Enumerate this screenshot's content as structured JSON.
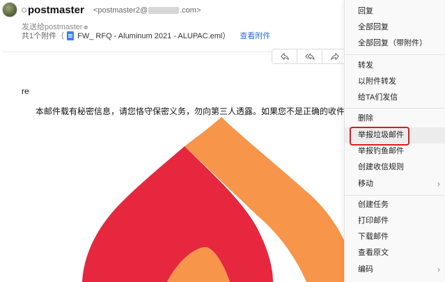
{
  "header": {
    "sender_name": "postmaster",
    "sender_email_prefix": "<postmaster2@",
    "sender_email_suffix": ".com>",
    "to_label": "发送给postmaster",
    "to_caret": "≑",
    "attachment_count_label": "共1个附件（",
    "attachment_name": "FW_ RFQ - Aluminum 2021 - ALUPAC.eml）",
    "view_attachment": "查看附件"
  },
  "body": {
    "greeting": "re",
    "disclaimer": "本邮件载有秘密信息，请您恪守保密义务，勿向第三人透露。如果您不是正确的收件人，请您立即删除"
  },
  "context_menu": {
    "items": [
      {
        "label": "回复"
      },
      {
        "label": "全部回复"
      },
      {
        "label": "全部回复（带附件）"
      },
      {
        "label": "转发"
      },
      {
        "label": "以附件转发"
      },
      {
        "label": "给TA们发信"
      },
      {
        "label": "删除"
      },
      {
        "label": "举报垃圾邮件"
      },
      {
        "label": "举报钓鱼邮件"
      },
      {
        "label": "创建收信规则"
      },
      {
        "label": "移动",
        "submenu": true
      },
      {
        "label": "创建任务"
      },
      {
        "label": "打印邮件"
      },
      {
        "label": "下载邮件"
      },
      {
        "label": "查看原文"
      },
      {
        "label": "编码",
        "submenu": true
      }
    ],
    "submenu_chevron": "›",
    "highlighted_item": "举报垃圾邮件"
  },
  "colors": {
    "logo_red": "#e6273e",
    "logo_orange": "#f7954a",
    "highlight_border": "#e4161f",
    "link": "#2f6fd6"
  }
}
